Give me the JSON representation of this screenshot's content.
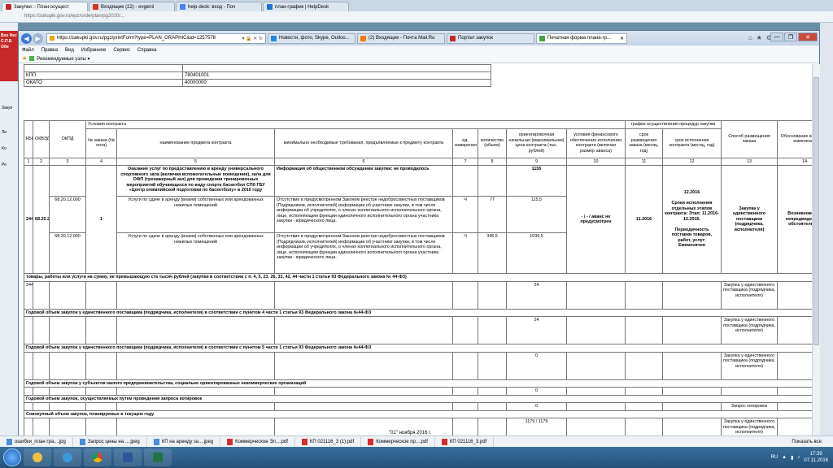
{
  "outer_browser": {
    "tabs": [
      "Закупки :: План осущест",
      "Входящие (22) - evgenii",
      "help-desk: вход - Поч",
      "план-график | HelpDesk"
    ],
    "address": "https://zakupki.gov.ru/epz/orderplan/pg2020/...",
    "left_banner": "Вхо Нес С.П.Б Обе",
    "left_labels": [
      "Закуп",
      "Ли",
      "Ко",
      "Ре"
    ]
  },
  "ie": {
    "address": "https://zakupki.gov.ru/pgz/printForm?type=PLAN_GRAPHIC&id=1257578",
    "address_tools": "▾ 🔒 ✕ ↻",
    "tabs": [
      {
        "label": "Новости, фото, Skype, Outloo...",
        "color": "#1e88e5"
      },
      {
        "label": "(2) Входящие - Почта Mail.Ru",
        "color": "#f57c00"
      },
      {
        "label": "Портал закупок",
        "color": "#c62828"
      },
      {
        "label": "Печатная форма плана-гр...",
        "color": "#43a047"
      }
    ],
    "window_buttons": [
      "—",
      "❐",
      "✕"
    ],
    "toolbar_icons": [
      "⌂",
      "★",
      "⚙"
    ],
    "menu": [
      "Файл",
      "Правка",
      "Вид",
      "Избранное",
      "Сервис",
      "Справка"
    ],
    "favorites": "Рекомендуемые узлы ▾"
  },
  "info_rows": [
    {
      "label": "КПП",
      "value": "780401001"
    },
    {
      "label": "ОКАТО",
      "value": "40000000"
    }
  ],
  "table": {
    "group_header": "Условия контракта",
    "schedule_header": "график осуществления процедур закупки",
    "headers": {
      "kbk": "КБК",
      "okved": "ОКВЭД",
      "okpd": "ОКПД",
      "num": "№ заказа (№ лота)",
      "name": "наименование предмета контракта",
      "req": "минимально необходимые требования, предъявляемые к предмету контракта",
      "unit": "ед. измерения",
      "qty": "количество (объем)",
      "price": "ориентировочная начальная (максимальная) цена контракта (тыс. рублей)",
      "fin": "условия финансового обеспечения исполнения контракта (включая размер аванса)",
      "placing": "срок размещения заказа (месяц, год)",
      "exec": "срок исполнения контракта (месяц, год)",
      "method": "Способ размещения заказа",
      "reason": "Обоснование внесения изменений"
    },
    "col_numbers": [
      "1",
      "2",
      "3",
      "4",
      "5",
      "6",
      "7",
      "8",
      "9",
      "10",
      "11",
      "12",
      "13",
      "14"
    ],
    "lot": {
      "kbk": "244",
      "okved": "68.20.2",
      "num": "1",
      "title": "Оказание услуг по предоставлению в аренду универсального спортивного зала (включая вспомогательные помещения), зала для ОФП (тренажерный зал) для проведения тренировочных мероприятий обучающихся по виду спорта баскетбол СПб ГБУ «Центр олимпийской подготовки по баскетболу» в 2016 году",
      "title_req": "Информация об общественном обсуждении закупки: не проводилось",
      "total_price": "1155",
      "fin": "- / - / аванс не предусмотрен",
      "placing": "11.2016",
      "exec": "12.2016\n\nСроки исполнения отдельных этапов контракта: Этап: 11.2016-12.2016.\n\nПериодичность поставки товаров, работ, услуг: Ежемесячно",
      "method": "Закупка у единственного поставщика (подрядчика, исполнителя)",
      "reason": "Возникновение непредвиденных обстоятельств",
      "items": [
        {
          "okpd": "68.20.12.000",
          "name": "Услуги по сдаче в аренду (внаем) собственных или арендованных нежилых помещений",
          "req": "Отсутствие в предусмотренном Законом реестре недобросовестных поставщиков (Подрядчиков, исполнителей) информации об участнике закупки, в том числе информации об учредителях, о членах коллегиального исполнительного органа, лице, исполняющем функции единоличного исполнительного органа участника закупки - юридического лица.",
          "unit": "Ч",
          "qty": "77",
          "price": "115,5"
        },
        {
          "okpd": "68.20.12.000",
          "name": "Услуги по сдаче в аренду (внаем) собственных или арендованных нежилых помещений",
          "req": "Отсутствие в предусмотренном Законом реестре недобросовестных поставщиков (Подрядчиков, исполнителей) информации об участнике закупки, в том числе информации об учредителях, о членах коллегиального исполнительного органа, лице, исполняющем функции единоличного исполнительного органа участника закупки - юридического лица.",
          "unit": "Ч",
          "qty": "346,5",
          "price": "1039,5"
        }
      ]
    },
    "sections": [
      {
        "title": "товары, работы или услуги на сумму, не превышающую ста тысяч рублей (закупки в соответствии с п. 4, 5, 23, 26, 33, 42, 44 части 1 статьи 93 Федерального закона № 44-ФЗ)",
        "kbk": "244",
        "price": "24",
        "method": "Закупка у единственного поставщика (подрядчика, исполнителя)"
      },
      {
        "title": "Годовой объем закупок у единственного поставщика (подрядчика, исполнителя) в соответствии с пунктом 4 части 1 статьи 93 Федерального закона №44-ФЗ",
        "kbk": "",
        "price": "24",
        "method": "Закупка у единственного поставщика (подрядчика, исполнителя)"
      },
      {
        "title": "Годовой объем закупок у единственного поставщика (подрядчика, исполнителя) в соответствии с пунктом 5 части 1 статьи 93 Федерального закона №44-ФЗ",
        "kbk": "",
        "price": "0",
        "method": "Закупка у единственного поставщика (подрядчика, исполнителя)"
      },
      {
        "title": "Годовой объем закупок у субъектов малого предпринимательства, социально ориентированных некоммерческих организаций",
        "kbk": "",
        "price": "0",
        "method": ""
      },
      {
        "title": "Годовой объем закупок, осуществляемых путем проведения запроса котировок",
        "kbk": "",
        "price": "0",
        "method": "Запрос котировок"
      },
      {
        "title": "Совокупный объем закупок, планируемых в текущем году",
        "kbk": "",
        "price": "1179 / 1179",
        "method": "Закупка у единственного поставщика (подрядчика, исполнителя)"
      }
    ]
  },
  "footer_date": "\"01\" ноября 2016 г.",
  "downloads": [
    {
      "name": "ошибки_план гра....jpg",
      "color": "#4a90d9"
    },
    {
      "name": "Запрос цены на ....jpeg",
      "color": "#4a90d9"
    },
    {
      "name": "КП на аренду за....jpeg",
      "color": "#4a90d9"
    },
    {
      "name": "Коммерческое Эл....pdf",
      "color": "#d32f2f"
    },
    {
      "name": "КП 021116_3 (1).pdf",
      "color": "#d32f2f"
    },
    {
      "name": "Коммерческое пр....pdf",
      "color": "#d32f2f"
    },
    {
      "name": "КП 021116_3.pdf",
      "color": "#d32f2f"
    }
  ],
  "downloads_show_all": "Показать все",
  "taskbar": {
    "lang": "RU",
    "time": "17:39",
    "date": "07.11.2016"
  }
}
